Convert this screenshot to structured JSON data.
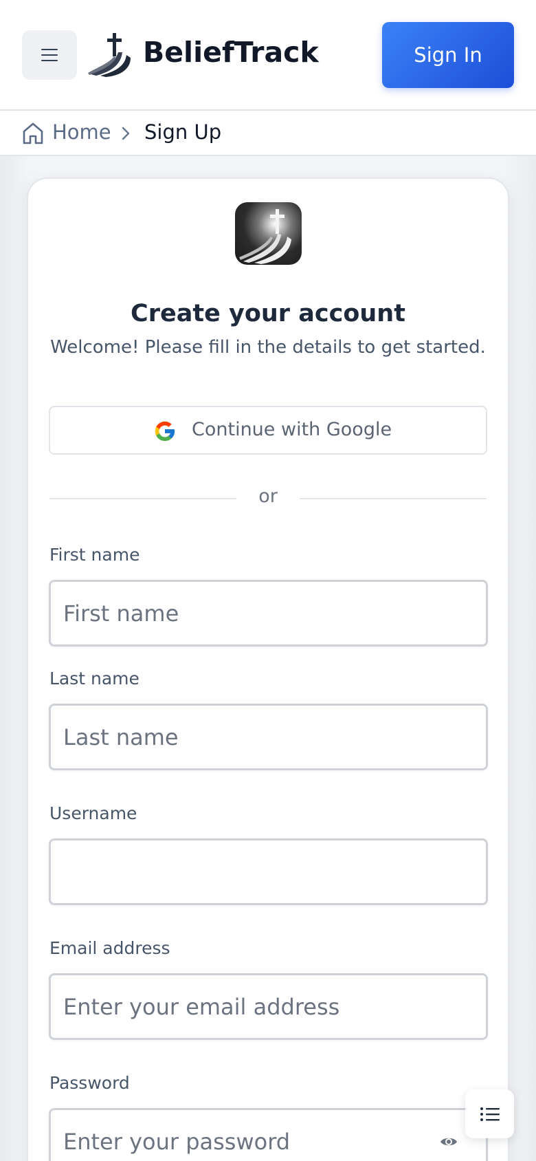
{
  "header": {
    "brand_name": "BeliefTrack",
    "signin_label": "Sign In",
    "accent_color": "#2563eb"
  },
  "breadcrumb": {
    "home_label": "Home",
    "current_label": "Sign Up"
  },
  "card": {
    "title": "Create your account",
    "subtitle": "Welcome! Please fill in the details to get started.",
    "google_label": "Continue with Google",
    "divider_text": "or"
  },
  "form": {
    "first_name": {
      "label": "First name",
      "placeholder": "First name",
      "value": ""
    },
    "last_name": {
      "label": "Last name",
      "placeholder": "Last name",
      "value": ""
    },
    "username": {
      "label": "Username",
      "placeholder": "",
      "value": ""
    },
    "email": {
      "label": "Email address",
      "placeholder": "Enter your email address",
      "value": ""
    },
    "password": {
      "label": "Password",
      "placeholder": "Enter your password",
      "value": ""
    }
  },
  "icons": {
    "menu": "hamburger-icon",
    "brand": "cross-path-logo",
    "home": "home-icon",
    "chevron": "chevron-right-icon",
    "google": "google-g-icon",
    "eye": "eye-icon",
    "toc": "list-icon"
  }
}
